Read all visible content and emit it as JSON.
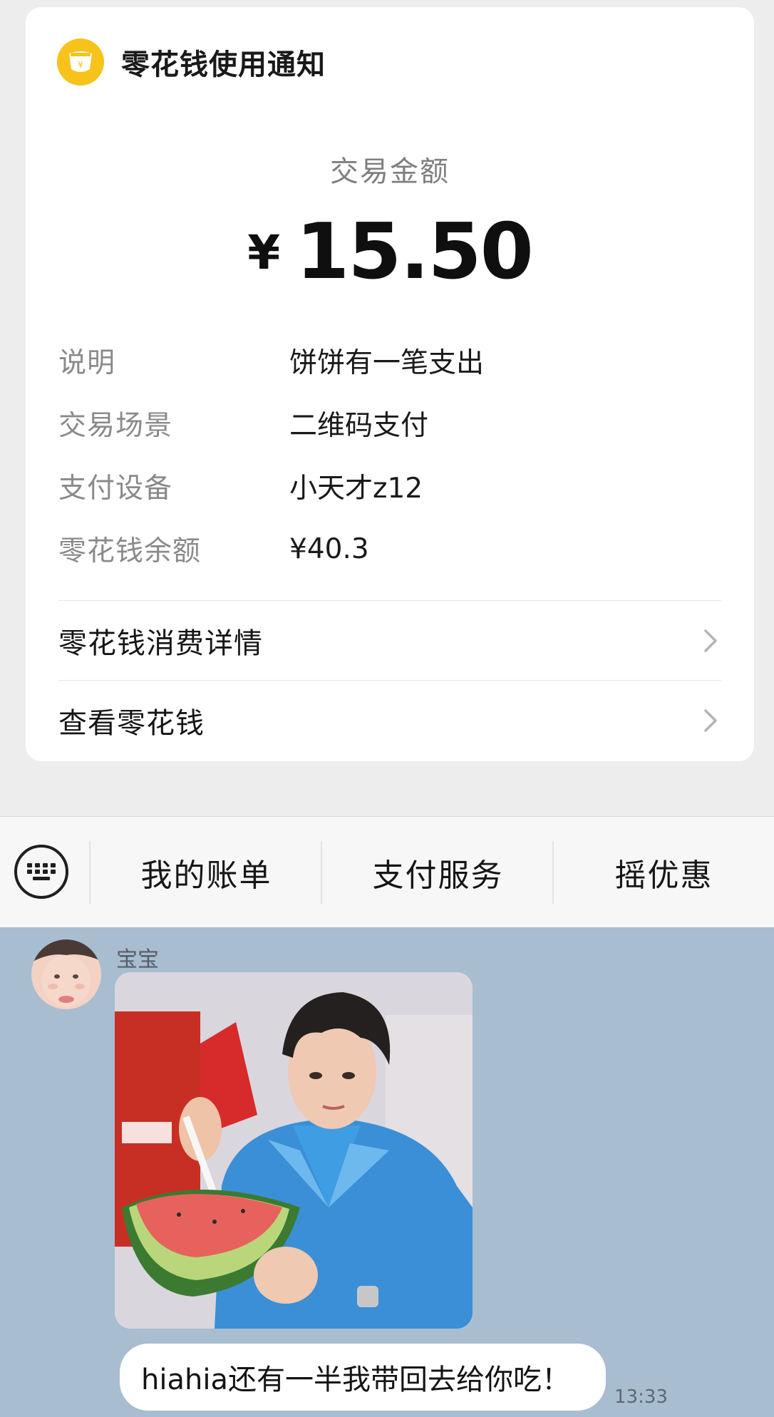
{
  "notification": {
    "title": "零花钱使用通知",
    "logo_icon": "coin-purse-icon",
    "logo_color": "#f7c21a",
    "amount_label": "交易金额",
    "currency_symbol": "¥",
    "amount_value": "15.50",
    "details": [
      {
        "key": "说明",
        "value": "饼饼有一笔支出"
      },
      {
        "key": "交易场景",
        "value": "二维码支付"
      },
      {
        "key": "支付设备",
        "value": "小天才z12"
      },
      {
        "key": "零花钱余额",
        "value": "¥40.3"
      }
    ],
    "links": [
      {
        "label": "零花钱消费详情",
        "icon": "chevron-right-icon"
      },
      {
        "label": "查看零花钱",
        "icon": "chevron-right-icon"
      }
    ]
  },
  "menu": {
    "keyboard_icon": "keyboard-icon",
    "items": [
      {
        "label": "我的账单"
      },
      {
        "label": "支付服务"
      },
      {
        "label": "摇优惠"
      }
    ]
  },
  "chat": {
    "background_color": "#a8bdd0",
    "sender_name": "宝宝",
    "photo_icon": "photo-message",
    "message_text": "hiahia还有一半我带回去给你吃！",
    "timestamp": "13:33"
  }
}
